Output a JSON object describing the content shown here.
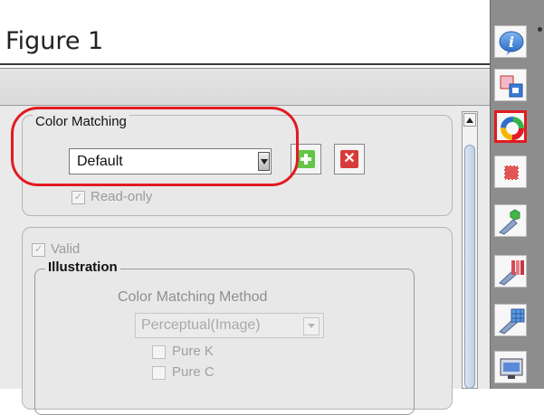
{
  "window": {
    "title": "Figure 1"
  },
  "color_matching": {
    "legend": "Color Matching",
    "selected_profile": "Default",
    "delete_label": "✕",
    "read_only_label": "Read-only",
    "read_only_checked": true
  },
  "valid": {
    "label": "Valid",
    "checked": true
  },
  "illustration": {
    "legend": "Illustration",
    "method_label": "Color Matching Method",
    "method_value": "Perceptual(Image)",
    "options": [
      {
        "label": "Pure K",
        "checked": false
      },
      {
        "label": "Pure C",
        "checked": false
      }
    ]
  },
  "toolbar": {
    "items": [
      {
        "name": "info-icon"
      },
      {
        "name": "layout-icon"
      },
      {
        "name": "color-matching-icon",
        "selected": true
      },
      {
        "name": "spot-color-icon"
      },
      {
        "name": "cut-shape-icon"
      },
      {
        "name": "color-bars-icon"
      },
      {
        "name": "grid-fill-icon"
      },
      {
        "name": "print-media-icon"
      }
    ]
  },
  "colors": {
    "highlight": "#e11b22",
    "add_green": "#62c646",
    "delete_red": "#d83b3b",
    "toolbar_gray": "#8d8d8d"
  }
}
